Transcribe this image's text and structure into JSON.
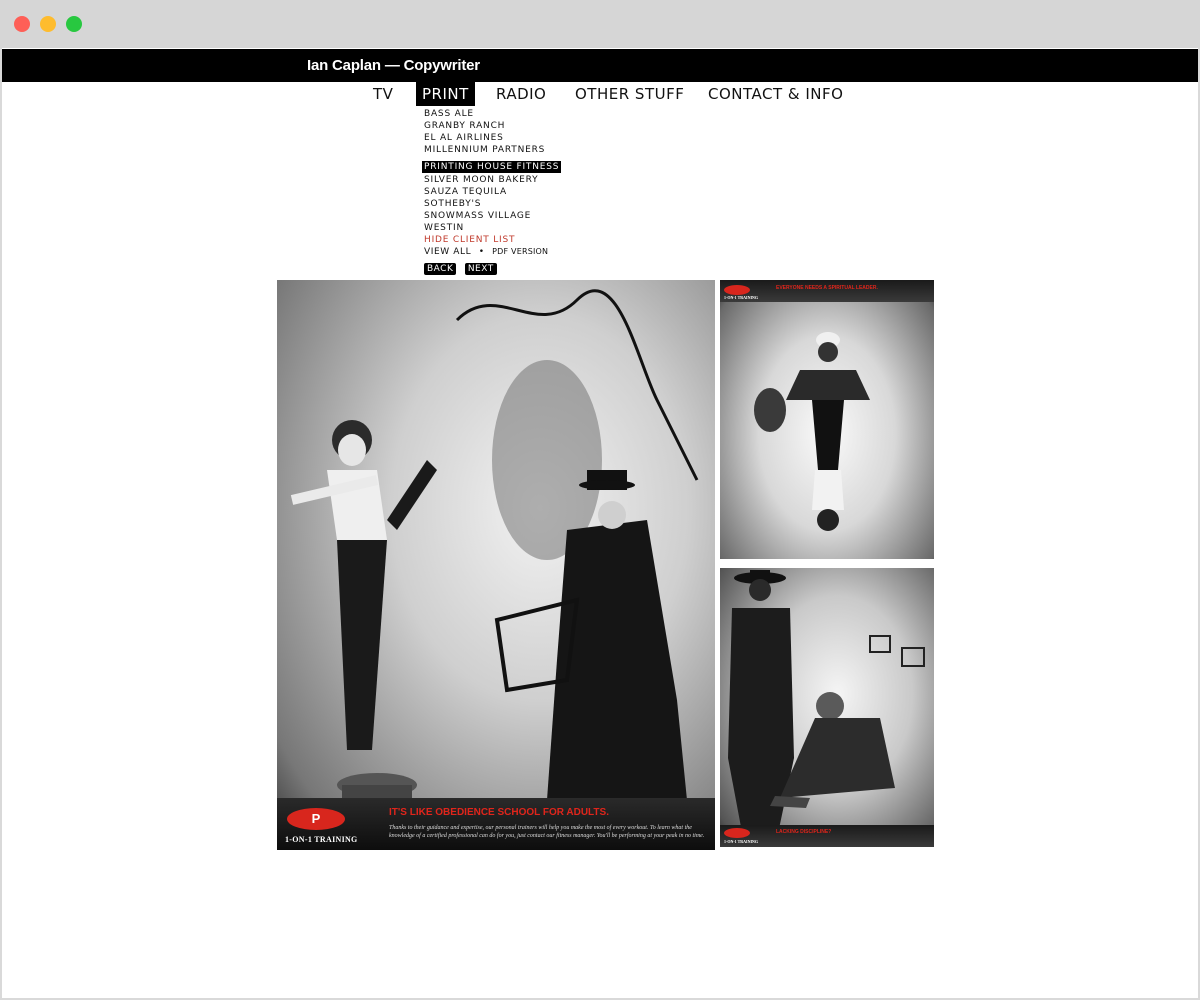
{
  "site": {
    "title": "Ian Caplan — Copywriter"
  },
  "nav": {
    "items": [
      {
        "label": "TV"
      },
      {
        "label": "PRINT"
      },
      {
        "label": "RADIO"
      },
      {
        "label": "OTHER STUFF"
      },
      {
        "label": "CONTACT & INFO"
      }
    ],
    "active": "PRINT"
  },
  "clients": {
    "items": [
      "BASS ALE",
      "GRANBY RANCH",
      "EL AL AIRLINES",
      "MILLENNIUM PARTNERS",
      "PRINTING HOUSE FITNESS",
      "SILVER MOON BAKERY",
      "SAUZA TEQUILA",
      "SOTHEBY'S",
      "SNOWMASS VILLAGE",
      "WESTIN"
    ],
    "selected": "PRINTING HOUSE FITNESS",
    "hide_label": "HIDE CLIENT LIST",
    "view_all": "VIEW ALL",
    "separator": "•",
    "pdf_version": "PDF VERSION"
  },
  "pager": {
    "back": "BACK",
    "next": "NEXT"
  },
  "ads": {
    "main": {
      "logo_mark": "P",
      "logo_text": "1-ON-1 TRAINING",
      "headline": "IT'S LIKE OBEDIENCE SCHOOL FOR ADULTS.",
      "body": "Thanks to their guidance and expertise, our personal trainers will help you make the most of every workout. To learn what the knowledge of a certified professional can do for you, just contact our fitness manager. You'll be performing at your peak in no time."
    },
    "small1": {
      "logo_text": "1-ON-1 TRAINING",
      "headline": "EVERYONE NEEDS A SPIRITUAL LEADER."
    },
    "small2": {
      "logo_text": "1-ON-1 TRAINING",
      "headline": "LACKING DISCIPLINE?"
    }
  },
  "colors": {
    "accent_red": "#e0251b",
    "hide_link": "#c0392b",
    "header_bg": "#000000"
  }
}
